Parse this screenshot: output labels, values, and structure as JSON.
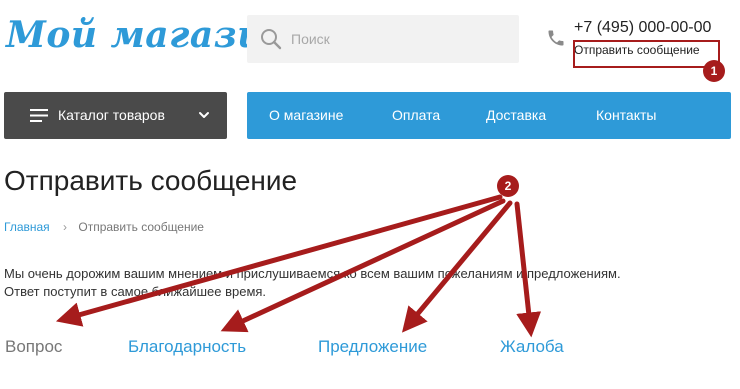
{
  "header": {
    "logo_text": "Мой магазин",
    "search": {
      "placeholder": "Поиск"
    },
    "phone": "+7 (495) 000-00-00",
    "send_message_link": "Отправить сообщение"
  },
  "catalog": {
    "label": "Каталог товаров"
  },
  "nav": {
    "items": [
      {
        "label": "О магазине"
      },
      {
        "label": "Оплата"
      },
      {
        "label": "Доставка"
      },
      {
        "label": "Контакты"
      }
    ]
  },
  "page": {
    "title": "Отправить сообщение",
    "breadcrumb": {
      "home": "Главная",
      "current": "Отправить сообщение"
    },
    "intro_line1": "Мы очень дорожим вашим мнением и прислушиваемся ко всем вашим пожеланиям и предложениям.",
    "intro_line2": "Ответ поступит в самое ближайшее время."
  },
  "message_types": [
    {
      "label": "Вопрос",
      "active": true
    },
    {
      "label": "Благодарность",
      "active": false
    },
    {
      "label": "Предложение",
      "active": false
    },
    {
      "label": "Жалоба",
      "active": false
    }
  ],
  "annotations": {
    "badge_1": "1",
    "badge_2": "2",
    "color": "#a61c1c"
  },
  "colors": {
    "accent": "#2e9ad8",
    "dark_button": "#4a4a4a",
    "search_bg": "#f2f2f2"
  }
}
